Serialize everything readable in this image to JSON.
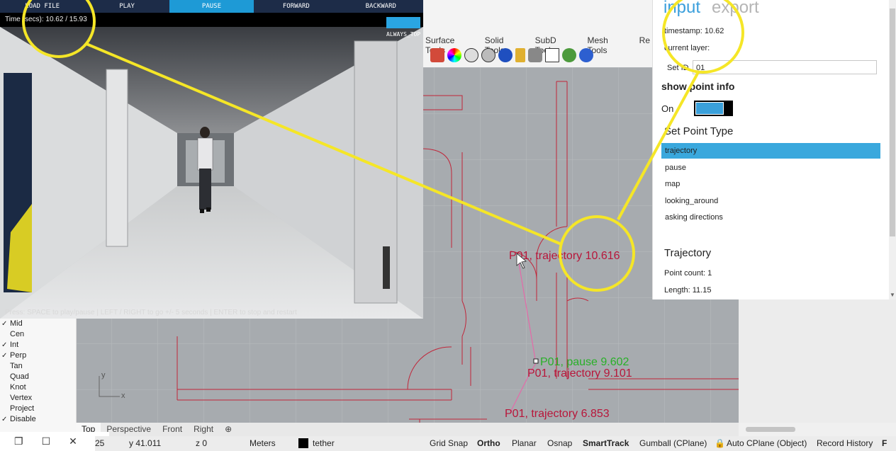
{
  "player": {
    "menu": [
      "LOAD FILE",
      "PLAY",
      "PAUSE",
      "FORWARD",
      "BACKWARD"
    ],
    "time_label": "Time (secs):  10.62 / 15.93",
    "always_top": "ALWAYS_TOP",
    "hint": "Press: SPACE to play/pause | LEFT / RIGHT to go +/- 5 seconds | ENTER to stop and restart"
  },
  "rhino": {
    "tabs": [
      "Surface Tools",
      "Solid Tools",
      "SubD Tools",
      "Mesh Tools",
      "Re"
    ],
    "viewport_labels": {
      "p1": "P01, trajectory 10.616",
      "p2": "P01, pause 9.602",
      "p3": "P01, trajectory 9.101",
      "p4": "P01, trajectory 6.853",
      "axis_y": "y",
      "axis_x": "x"
    },
    "snaps": [
      {
        "label": "Mid",
        "checked": true
      },
      {
        "label": "Cen",
        "checked": false
      },
      {
        "label": "Int",
        "checked": true
      },
      {
        "label": "Perp",
        "checked": true
      },
      {
        "label": "Tan",
        "checked": false
      },
      {
        "label": "Quad",
        "checked": false
      },
      {
        "label": "Knot",
        "checked": false
      },
      {
        "label": "Vertex",
        "checked": false
      },
      {
        "label": "Project",
        "checked": false
      },
      {
        "label": "Disable",
        "checked": true
      }
    ],
    "viewport_tabs": [
      "Top",
      "Perspective",
      "Front",
      "Right"
    ],
    "status": {
      "coord_a": "25",
      "coord_y": "y 41.011",
      "coord_z": "z 0",
      "units": "Meters",
      "layer": "tether",
      "grid_snap": "Grid Snap",
      "ortho": "Ortho",
      "planar": "Planar",
      "osnap": "Osnap",
      "smarttrack": "SmartTrack",
      "gumball": "Gumball (CPlane)",
      "auto_cplane": "Auto CPlane (Object)",
      "record_history": "Record History",
      "f": "F"
    }
  },
  "panel": {
    "tab_input": "input",
    "tab_export": "export",
    "timestamp": "timestamp: 10.62",
    "current_layer": "current layer:",
    "set_id_label": "Set ID",
    "set_id_value": "01",
    "show_point_info": "show point info",
    "on_label": "On",
    "set_point_type": "Set Point Type",
    "point_types": [
      "trajectory",
      "pause",
      "map",
      "looking_around",
      "asking directions"
    ],
    "trajectory_heading": "Trajectory",
    "point_count": "Point count: 1",
    "length": "Length: 11.15"
  },
  "colors": {
    "accent": "#3aa8dd",
    "annotation": "#f5e627",
    "wall": "#c0263a",
    "label_red": "#b8163a",
    "label_green": "#28b027"
  }
}
